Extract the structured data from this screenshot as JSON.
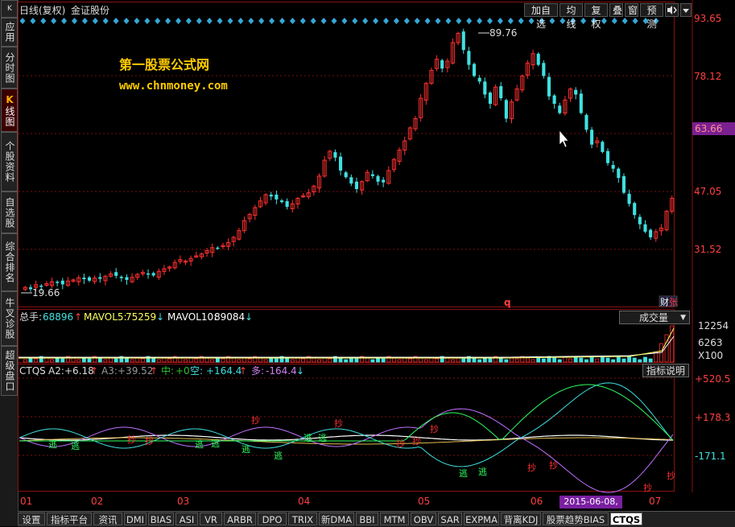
{
  "sidebar": {
    "tabs": [
      {
        "label": "应用"
      },
      {
        "label": "分时图"
      },
      {
        "label": "K线图",
        "prefix": "K",
        "rest": "线图"
      },
      {
        "label": "个股资料"
      },
      {
        "label": "自选股"
      },
      {
        "label": "综合排名"
      },
      {
        "label": "牛叉诊股"
      },
      {
        "label": "超级盘口"
      }
    ]
  },
  "header": {
    "period": "日线(复权)",
    "stock": "金证股份",
    "buttons": [
      "加自选",
      "均线",
      "复权",
      "叠",
      "窗",
      "预测"
    ],
    "nav_icon": "speaker-arrow-icon",
    "menu_icon": "dropdown-triangle-icon"
  },
  "watermark": {
    "name": "第一股票公式网",
    "url": "www.chnmoney.com"
  },
  "price_axis": {
    "labels": [
      "93.65",
      "78.12",
      "63.66",
      "47.05",
      "31.52"
    ],
    "highlight": "63.66",
    "highlight_color": "#7a2090"
  },
  "annotations": {
    "high": "89.76",
    "low": "19.66",
    "q_marker": "q",
    "badge": "财",
    "badge2": "张"
  },
  "volume": {
    "title": "总手:",
    "total": "68896",
    "mavol5_label": "MAVOL5:",
    "mavol5": "75259",
    "mavol10_label": "MAVOL10:",
    "mavol10": "89084",
    "dropdown": "成交量",
    "axis": [
      "12254",
      "6263",
      "X100"
    ]
  },
  "indicator": {
    "name": "CTQS",
    "a2_label": "A2:",
    "a2": "+6.18",
    "a3_label": "A3:",
    "a3": "+39.52",
    "mid_label": "中:",
    "mid": "+0",
    "kong_label": "空:",
    "kong": "+164.4",
    "duo_label": "多:",
    "duo": "-164.4",
    "help": "指标说明",
    "axis": [
      "+520.5",
      "+178.3",
      "-171.1"
    ],
    "sell_char": "抄",
    "run_char": "逃"
  },
  "time_axis": {
    "labels": [
      "01",
      "02",
      "03",
      "04",
      "05",
      "06",
      "07"
    ],
    "current_date": "2015-06-08,—"
  },
  "bottom_tabs": [
    "设置",
    "指标平台",
    "资讯",
    "DMI",
    "BIAS",
    "ASI",
    "VR",
    "ARBR",
    "DPO",
    "TRIX",
    "新DMA",
    "BBI",
    "MTM",
    "OBV",
    "SAR",
    "EXPMA",
    "背离KDJ",
    "股票趋势BIAS",
    "CTQS"
  ],
  "active_tab": "CTQS",
  "colors": {
    "up": "#ff3030",
    "down": "#40e0e0",
    "grid": "#7a1010",
    "text_yellow": "#ffcc00",
    "diamond": "#35a8d8"
  },
  "chart_data": {
    "type": "candlestick",
    "ylim": [
      19.66,
      93.65
    ],
    "high_value": 89.76,
    "low_value": 19.66,
    "closes": [
      20.5,
      20.0,
      21.2,
      20.8,
      21.5,
      22.0,
      21.8,
      21.3,
      22.2,
      22.5,
      23.1,
      22.7,
      22.3,
      23.0,
      22.8,
      23.5,
      24.1,
      23.6,
      23.0,
      22.5,
      23.2,
      24.0,
      24.5,
      24.1,
      23.7,
      24.8,
      25.5,
      26.0,
      27.2,
      28.0,
      27.6,
      28.3,
      29.0,
      29.5,
      30.4,
      31.2,
      31.0,
      31.8,
      32.6,
      34.0,
      35.8,
      38.5,
      40.2,
      42.0,
      43.8,
      45.5,
      45.0,
      44.2,
      43.5,
      42.2,
      43.0,
      44.5,
      45.2,
      46.0,
      47.8,
      50.5,
      54.8,
      57.2,
      55.5,
      52.0,
      50.2,
      48.5,
      47.0,
      49.0,
      51.5,
      50.5,
      49.0,
      48.8,
      52.0,
      55.0,
      57.5,
      60.0,
      63.5,
      66.0,
      71.5,
      75.5,
      79.0,
      82.0,
      79.5,
      81.5,
      86.5,
      89.0,
      84.5,
      80.5,
      77.5,
      76.0,
      72.5,
      70.0,
      74.5,
      71.5,
      66.0,
      70.5,
      74.0,
      77.5,
      81.0,
      83.5,
      80.5,
      77.5,
      72.0,
      70.0,
      67.5,
      71.0,
      74.0,
      72.5,
      67.5,
      63.0,
      59.0,
      60.0,
      57.0,
      54.0,
      52.5,
      50.0,
      46.0,
      43.0,
      40.0,
      37.5,
      35.5,
      34.0,
      35.5,
      36.5,
      41.0,
      44.5
    ]
  }
}
